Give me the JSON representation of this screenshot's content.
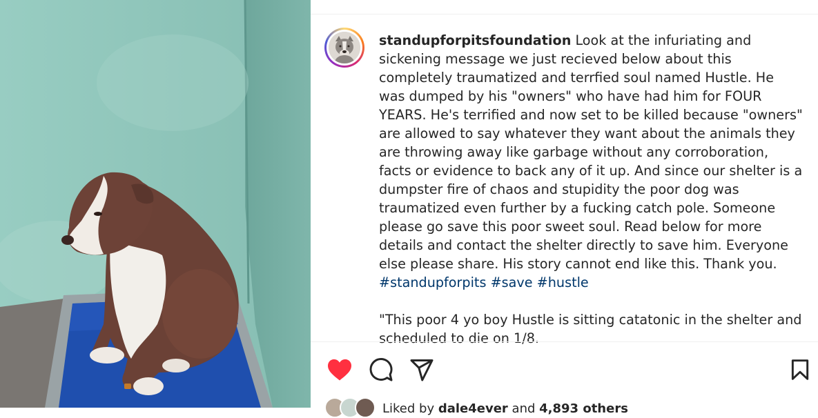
{
  "post": {
    "username": "standupforpitsfoundation",
    "caption_main": " Look at the infuriating and sickening message we just recieved below about this completely traumatized and terrfied soul named Hustle. He was dumped by his \"owners\" who have had him for FOUR YEARS. He's terrified and now set to be killed because \"owners\" are allowed to say whatever they want about the animals they are throwing away like garbage without any corroboration, facts or evidence to back any of it up. And since our shelter is a dumpster fire of chaos and stupidity the poor dog was traumatized even further by a fucking catch pole. Someone please go save this poor sweet soul. Read below for more details and contact the shelter directly to save him. Everyone else please share. His story cannot end like this. Thank you. ",
    "hashtags": [
      "#standupforpits",
      "#save",
      "#hustle"
    ],
    "caption_quote": "\"This poor 4 yo boy Hustle is sitting catatonic in the shelter and scheduled to die on 1/8."
  },
  "likes": {
    "prefix": "Liked by ",
    "user": "dale4ever",
    "middle": " and ",
    "count": "4,893 others"
  },
  "icons": {
    "like": "heart-filled-icon",
    "comment": "comment-bubble-icon",
    "share": "paper-plane-icon",
    "save": "bookmark-icon"
  },
  "colors": {
    "like": "#ff3040",
    "hashtag": "#00376b",
    "text": "#262626"
  }
}
